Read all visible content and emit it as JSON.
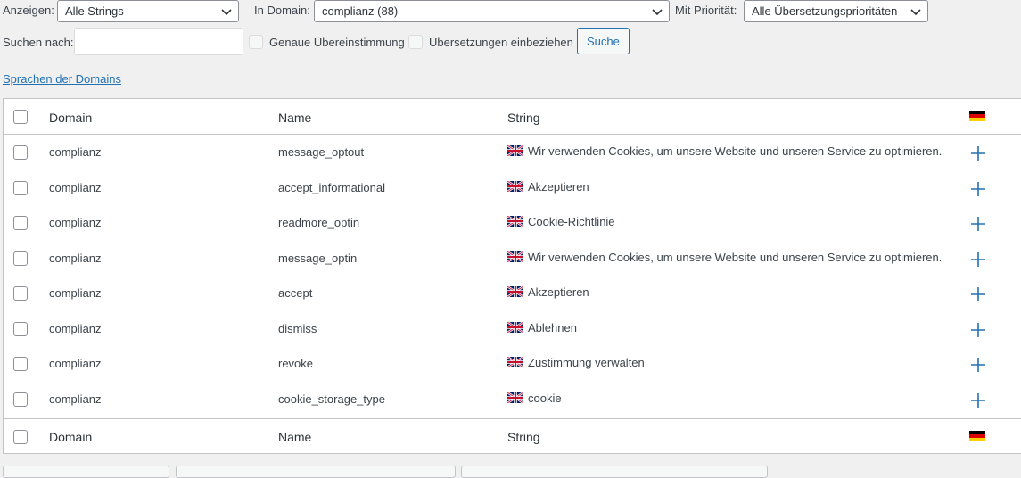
{
  "filters": {
    "show_label": "Anzeigen:",
    "show_value": "Alle Strings",
    "domain_label": "In Domain:",
    "domain_value": "complianz (88)",
    "priority_label": "Mit Priorität:",
    "priority_value": "Alle Übersetzungsprioritäten",
    "search_label": "Suchen nach:",
    "search_value": "",
    "exact_match_label": "Genaue Übereinstimmung",
    "include_translations_label": "Übersetzungen einbeziehen",
    "search_button": "Suche"
  },
  "domain_languages_link": "Sprachen der Domains",
  "table": {
    "columns": {
      "domain": "Domain",
      "name": "Name",
      "string": "String"
    },
    "rows": [
      {
        "domain": "complianz",
        "name": "message_optout",
        "string": "Wir verwenden Cookies, um unsere Website und unseren Service zu optimieren."
      },
      {
        "domain": "complianz",
        "name": "accept_informational",
        "string": "Akzeptieren"
      },
      {
        "domain": "complianz",
        "name": "readmore_optin",
        "string": "Cookie-Richtlinie"
      },
      {
        "domain": "complianz",
        "name": "message_optin",
        "string": "Wir verwenden Cookies, um unsere Website und unseren Service zu optimieren."
      },
      {
        "domain": "complianz",
        "name": "accept",
        "string": "Akzeptieren"
      },
      {
        "domain": "complianz",
        "name": "dismiss",
        "string": "Ablehnen"
      },
      {
        "domain": "complianz",
        "name": "revoke",
        "string": "Zustimmung verwalten"
      },
      {
        "domain": "complianz",
        "name": "cookie_storage_type",
        "string": "cookie"
      }
    ]
  },
  "icons": {
    "source_flag": "uk-flag-icon",
    "target_flag": "german-flag-icon",
    "add_translation": "plus-icon",
    "dropdown": "chevron-down-icon"
  },
  "colors": {
    "link": "#2271b1",
    "plus": "#2271b1",
    "background": "#f0f0f1"
  }
}
